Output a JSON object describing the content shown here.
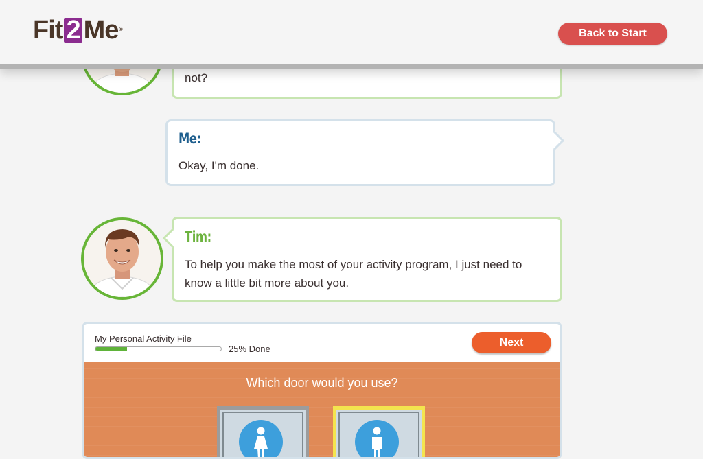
{
  "header": {
    "logo_prefix": "Fit",
    "logo_number": "2",
    "logo_suffix": "Me",
    "logo_tm": "®",
    "back_button": "Back to Start"
  },
  "conversation": [
    {
      "speaker": "",
      "text": "not?",
      "style": "coach",
      "avatar_icon": "coach-photo"
    },
    {
      "speaker": "Me:",
      "text": "Okay, I'm done.",
      "style": "user"
    },
    {
      "speaker": "Tim:",
      "text_line1": "To help you make the most of your activity program, I just need to",
      "text_line2": "know a little bit more about you.",
      "style": "coach",
      "avatar_icon": "coach-photo"
    }
  ],
  "activity_file": {
    "title": "My Personal Activity File",
    "progress_percent": 25,
    "progress_text": "25% Done",
    "next_button": "Next",
    "question": "Which door would you use?",
    "doors": [
      {
        "icon": "woman-restroom-icon",
        "selected": false
      },
      {
        "icon": "man-restroom-icon",
        "selected": true
      }
    ]
  },
  "colors": {
    "coach_green": "#6db33f",
    "user_blue": "#1f5f8e",
    "back_button": "#d9504e",
    "next_button": "#ec5e2c",
    "wall": "#e08a57",
    "selected_door": "#f3e44e",
    "logo_purple": "#8b2c8f"
  }
}
